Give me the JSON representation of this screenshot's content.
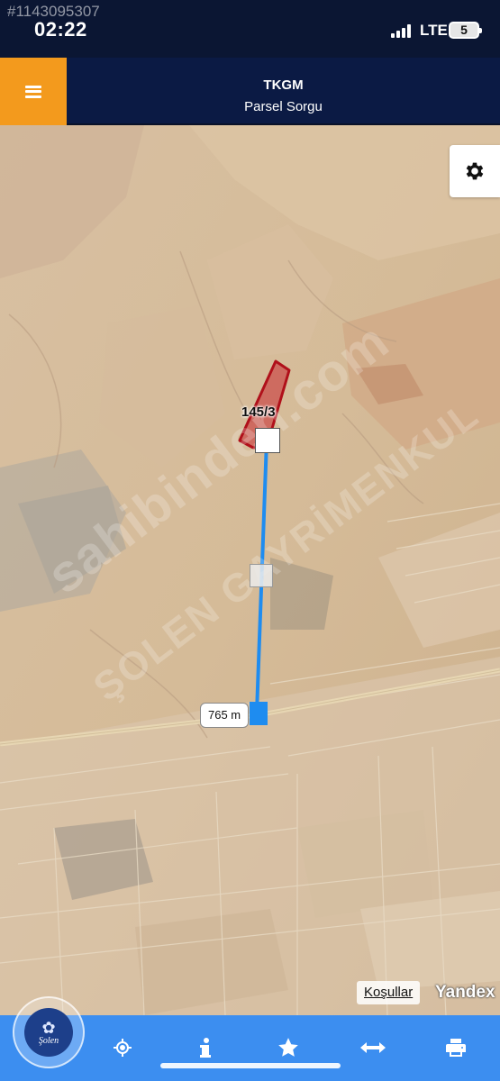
{
  "status_bar": {
    "listing_id": "#1143095307",
    "time": "02:22",
    "network": "LTE",
    "battery": "5"
  },
  "header": {
    "menu_icon": "hamburger-menu-icon",
    "title": "TKGM",
    "subtitle": "Parsel Sorgu"
  },
  "map": {
    "settings_icon": "gear-icon",
    "parcel_label": "145/3",
    "parcel_outline_color": "#b0101a",
    "measure_line_color": "#1e8cf0",
    "distance_label": "765 m",
    "watermark_line1": "sahibinden.com",
    "watermark_line2": "ŞOLEN GAYRİMENKUL",
    "terms_link": "Koşullar",
    "provider_logo": "Yandex"
  },
  "brand_badge": {
    "text": "Şolen"
  },
  "toolbar": {
    "color": "#3c8ef0",
    "items": [
      {
        "icon": "refresh-icon"
      },
      {
        "icon": "locate-crosshair-icon"
      },
      {
        "icon": "info-icon"
      },
      {
        "icon": "star-icon"
      },
      {
        "icon": "measure-arrows-icon"
      },
      {
        "icon": "print-icon"
      }
    ]
  }
}
